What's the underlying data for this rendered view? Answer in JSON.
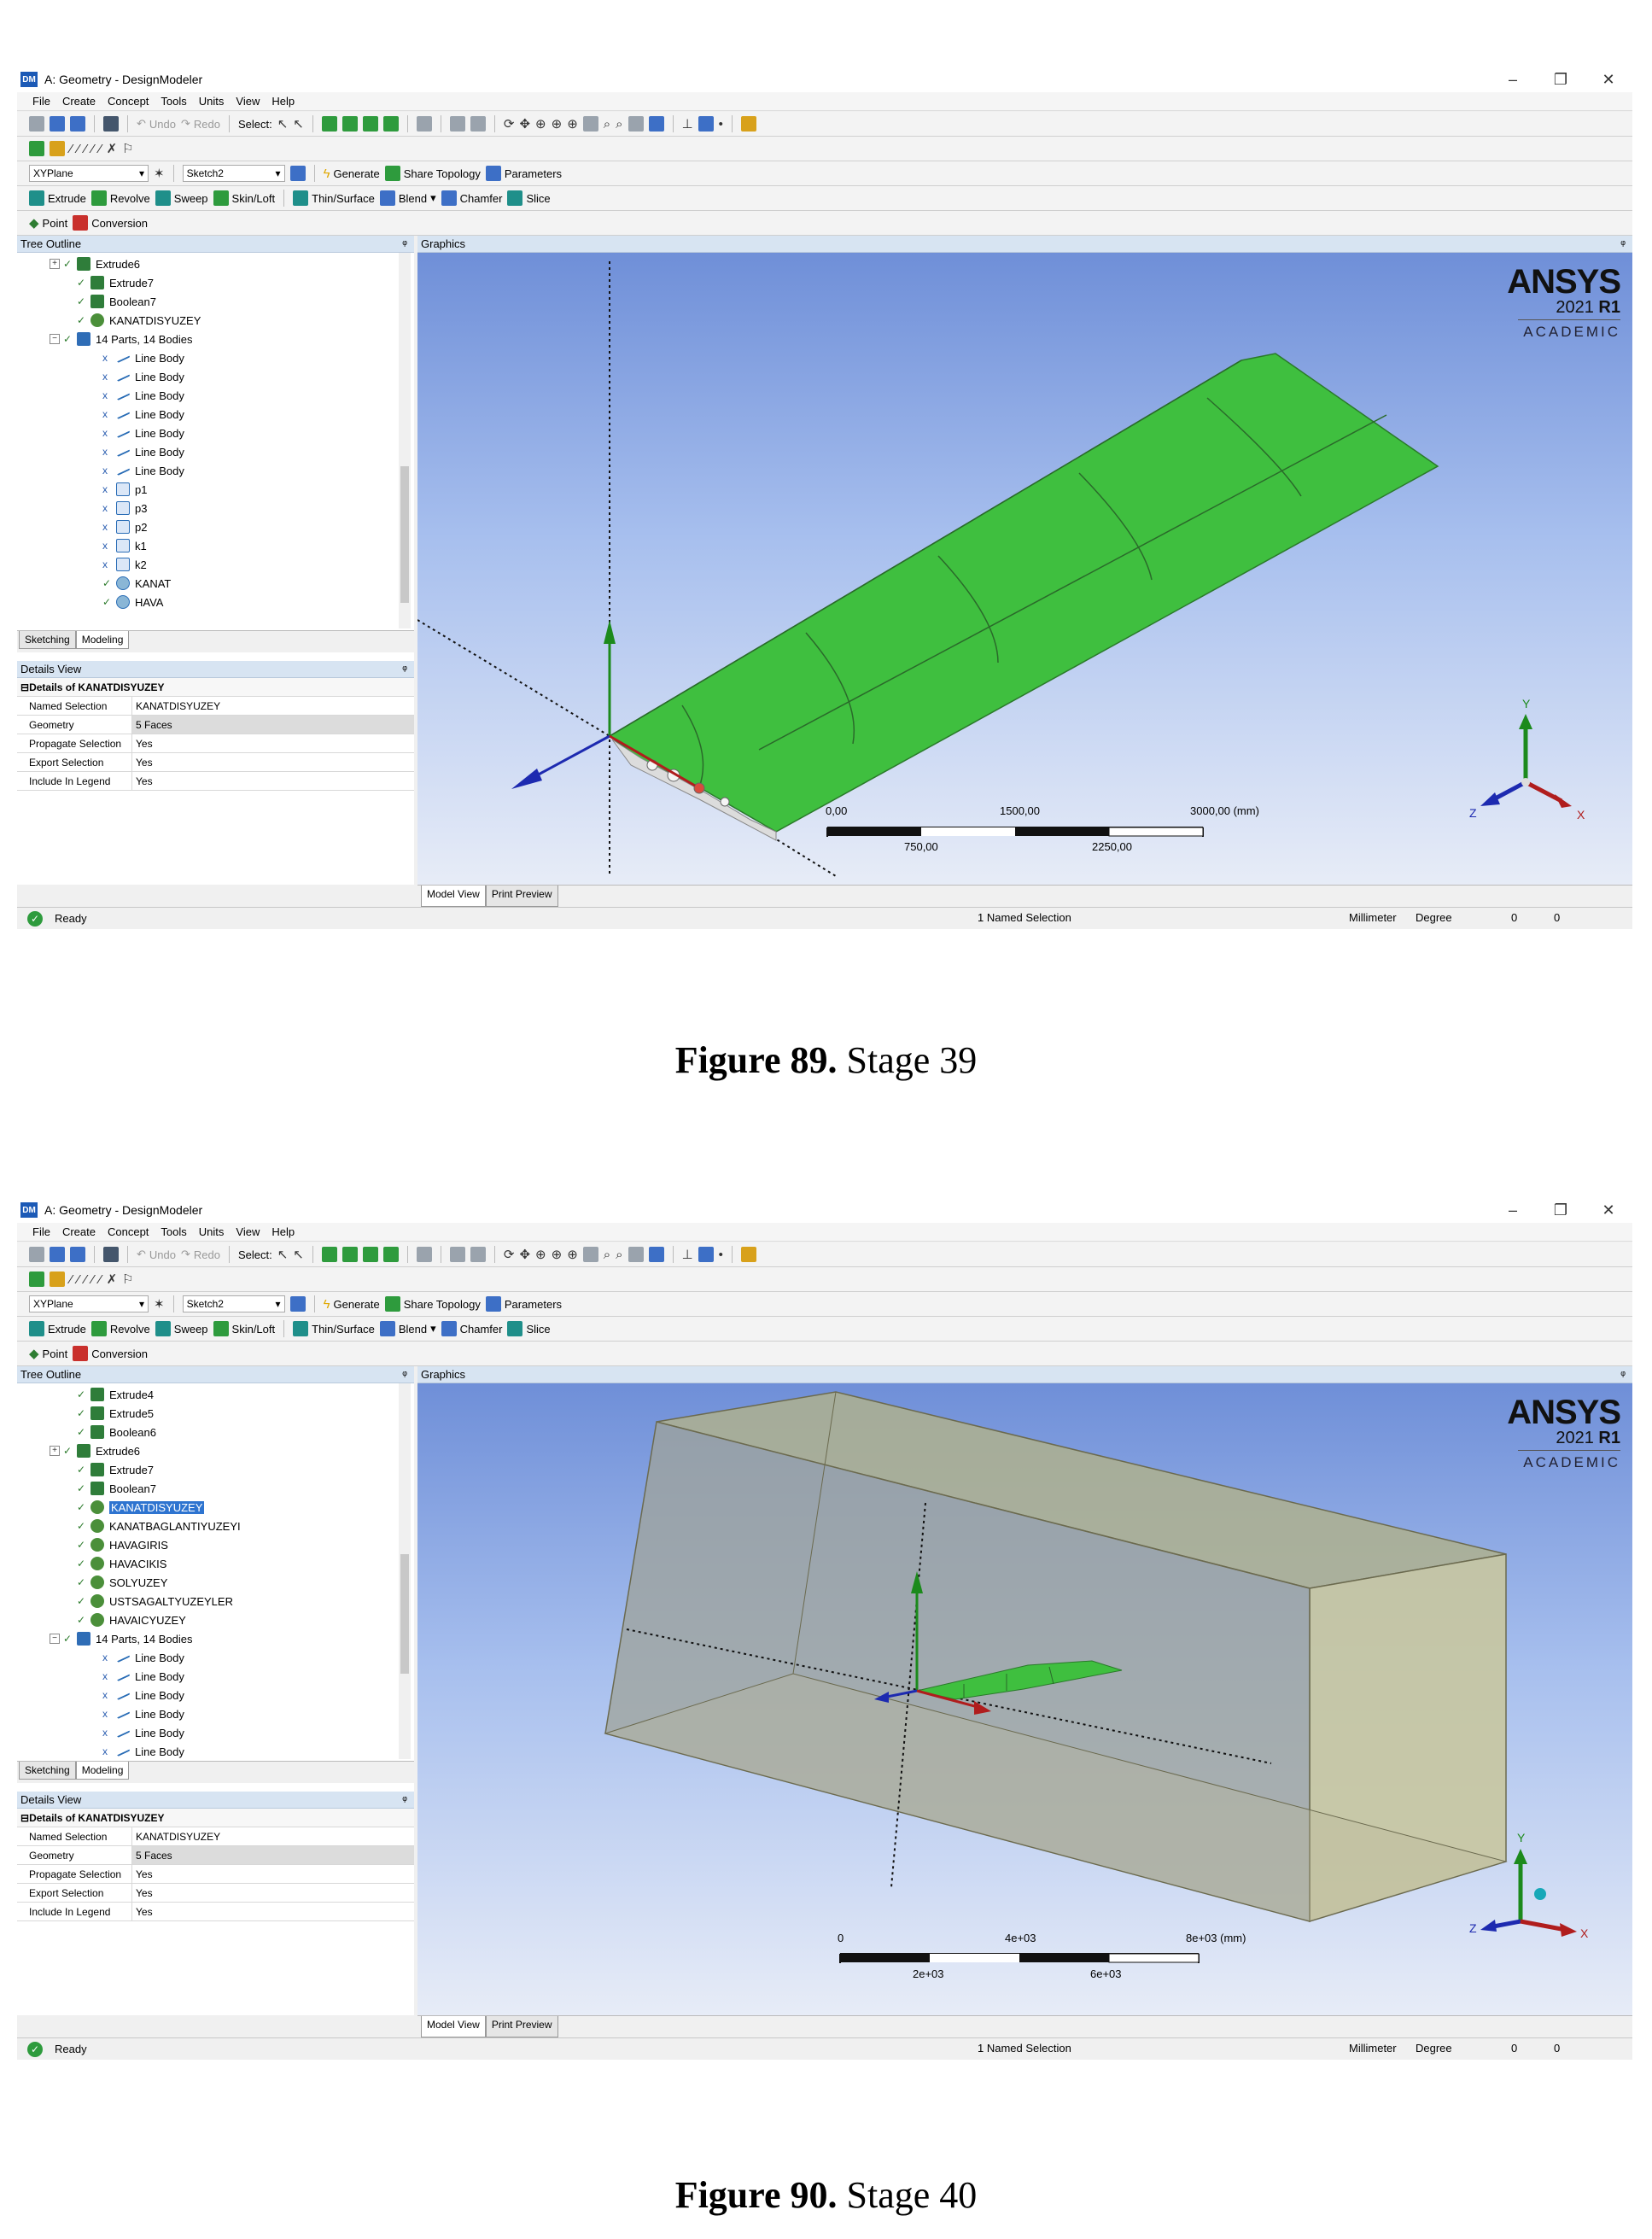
{
  "window": {
    "title": "A: Geometry - DesignModeler",
    "logo": "DM",
    "minimize": "–",
    "restore": "❐",
    "close": "✕"
  },
  "menu": [
    "File",
    "Create",
    "Concept",
    "Tools",
    "Units",
    "View",
    "Help"
  ],
  "toolbar": {
    "undo": "Undo",
    "redo": "Redo",
    "select": "Select:",
    "plane": "XYPlane",
    "sketch": "Sketch2",
    "generate": "Generate",
    "share_topology": "Share Topology",
    "parameters": "Parameters",
    "extrude": "Extrude",
    "revolve": "Revolve",
    "sweep": "Sweep",
    "skin_loft": "Skin/Loft",
    "thin_surface": "Thin/Surface",
    "blend": "Blend",
    "chamfer": "Chamfer",
    "slice": "Slice",
    "point": "Point",
    "conversion": "Conversion"
  },
  "panels": {
    "tree_outline": "Tree Outline",
    "graphics": "Graphics",
    "details_view": "Details View",
    "pin": "ᵠ"
  },
  "tabs": {
    "sketching": "Sketching",
    "modeling": "Modeling",
    "model_view": "Model View",
    "print_preview": "Print Preview"
  },
  "ansys": {
    "brand": "ANSYS",
    "year": "2021",
    "release": "R1",
    "edition": "ACADEMIC"
  },
  "axes": {
    "x": "X",
    "y": "Y",
    "z": "Z"
  },
  "status": {
    "ready": "Ready",
    "selection": "1 Named Selection",
    "units": "Millimeter",
    "angle": "Degree",
    "v1": "0",
    "v2": "0"
  },
  "details": {
    "header": "Details of KANATDISYUZEY",
    "rows": [
      {
        "k": "Named Selection",
        "v": "KANATDISYUZEY"
      },
      {
        "k": "Geometry",
        "v": "5 Faces"
      },
      {
        "k": "Propagate Selection",
        "v": "Yes"
      },
      {
        "k": "Export Selection",
        "v": "Yes"
      },
      {
        "k": "Include In Legend",
        "v": "Yes"
      }
    ]
  },
  "fig1": {
    "caption_bold": "Figure 89.",
    "caption_rest": "Stage 39",
    "tree": [
      "Extrude6",
      "Extrude7",
      "Boolean7",
      "KANATDISYUZEY",
      "14 Parts, 14 Bodies",
      "Line Body",
      "Line Body",
      "Line Body",
      "Line Body",
      "Line Body",
      "Line Body",
      "Line Body",
      "p1",
      "p3",
      "p2",
      "k1",
      "k2",
      "KANAT",
      "HAVA"
    ],
    "scale": {
      "t0": "0,00",
      "t1": "1500,00",
      "t2": "3000,00 (mm)",
      "b1": "750,00",
      "b2": "2250,00"
    }
  },
  "fig2": {
    "caption_bold": "Figure 90.",
    "caption_rest": "Stage 40",
    "tree": [
      "Extrude4",
      "Extrude5",
      "Boolean6",
      "Extrude6",
      "Extrude7",
      "Boolean7",
      "KANATDISYUZEY",
      "KANATBAGLANTIYUZEYI",
      "HAVAGIRIS",
      "HAVACIKIS",
      "SOLYUZEY",
      "USTSAGALTYUZEYLER",
      "HAVAICYUZEY",
      "14 Parts, 14 Bodies",
      "Line Body",
      "Line Body",
      "Line Body",
      "Line Body",
      "Line Body",
      "Line Body"
    ],
    "scale": {
      "t0": "0",
      "t1": "4e+03",
      "t2": "8e+03 (mm)",
      "b1": "2e+03",
      "b2": "6e+03"
    }
  },
  "colors": {
    "wing": "#3fbf3f",
    "domain": "#b7b48a",
    "selection": "#2e74d0"
  }
}
